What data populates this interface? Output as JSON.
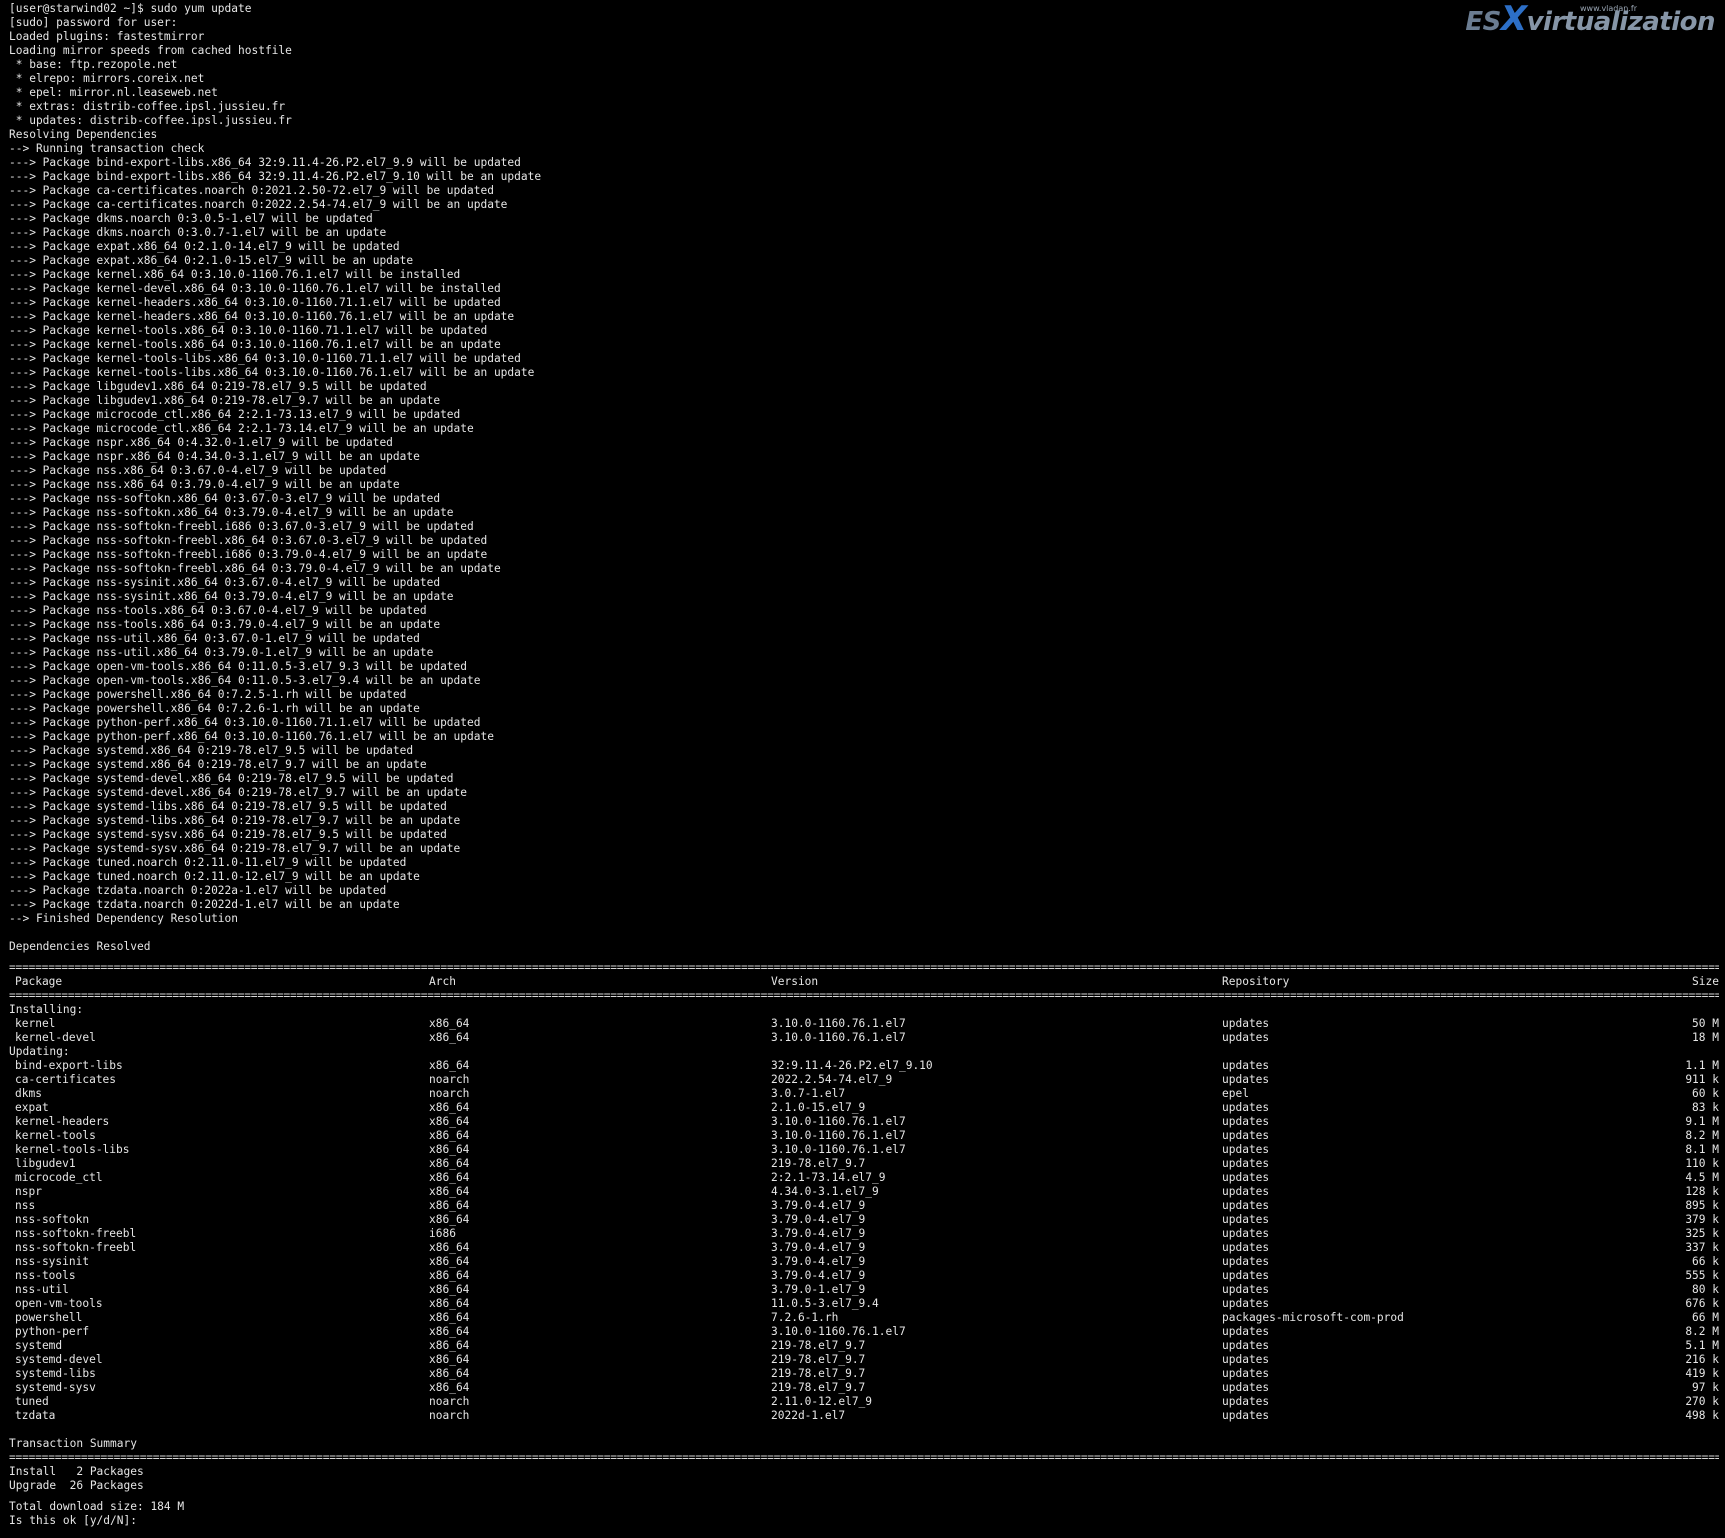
{
  "watermark": {
    "small": "www.vladan.fr",
    "es": "ES",
    "x": "X",
    "rest": "virtualization"
  },
  "log_lines": [
    "[user@starwind02 ~]$ sudo yum update",
    "[sudo] password for user:",
    "Loaded plugins: fastestmirror",
    "Loading mirror speeds from cached hostfile",
    " * base: ftp.rezopole.net",
    " * elrepo: mirrors.coreix.net",
    " * epel: mirror.nl.leaseweb.net",
    " * extras: distrib-coffee.ipsl.jussieu.fr",
    " * updates: distrib-coffee.ipsl.jussieu.fr",
    "Resolving Dependencies",
    "--> Running transaction check",
    "---> Package bind-export-libs.x86_64 32:9.11.4-26.P2.el7_9.9 will be updated",
    "---> Package bind-export-libs.x86_64 32:9.11.4-26.P2.el7_9.10 will be an update",
    "---> Package ca-certificates.noarch 0:2021.2.50-72.el7_9 will be updated",
    "---> Package ca-certificates.noarch 0:2022.2.54-74.el7_9 will be an update",
    "---> Package dkms.noarch 0:3.0.5-1.el7 will be updated",
    "---> Package dkms.noarch 0:3.0.7-1.el7 will be an update",
    "---> Package expat.x86_64 0:2.1.0-14.el7_9 will be updated",
    "---> Package expat.x86_64 0:2.1.0-15.el7_9 will be an update",
    "---> Package kernel.x86_64 0:3.10.0-1160.76.1.el7 will be installed",
    "---> Package kernel-devel.x86_64 0:3.10.0-1160.76.1.el7 will be installed",
    "---> Package kernel-headers.x86_64 0:3.10.0-1160.71.1.el7 will be updated",
    "---> Package kernel-headers.x86_64 0:3.10.0-1160.76.1.el7 will be an update",
    "---> Package kernel-tools.x86_64 0:3.10.0-1160.71.1.el7 will be updated",
    "---> Package kernel-tools.x86_64 0:3.10.0-1160.76.1.el7 will be an update",
    "---> Package kernel-tools-libs.x86_64 0:3.10.0-1160.71.1.el7 will be updated",
    "---> Package kernel-tools-libs.x86_64 0:3.10.0-1160.76.1.el7 will be an update",
    "---> Package libgudev1.x86_64 0:219-78.el7_9.5 will be updated",
    "---> Package libgudev1.x86_64 0:219-78.el7_9.7 will be an update",
    "---> Package microcode_ctl.x86_64 2:2.1-73.13.el7_9 will be updated",
    "---> Package microcode_ctl.x86_64 2:2.1-73.14.el7_9 will be an update",
    "---> Package nspr.x86_64 0:4.32.0-1.el7_9 will be updated",
    "---> Package nspr.x86_64 0:4.34.0-3.1.el7_9 will be an update",
    "---> Package nss.x86_64 0:3.67.0-4.el7_9 will be updated",
    "---> Package nss.x86_64 0:3.79.0-4.el7_9 will be an update",
    "---> Package nss-softokn.x86_64 0:3.67.0-3.el7_9 will be updated",
    "---> Package nss-softokn.x86_64 0:3.79.0-4.el7_9 will be an update",
    "---> Package nss-softokn-freebl.i686 0:3.67.0-3.el7_9 will be updated",
    "---> Package nss-softokn-freebl.x86_64 0:3.67.0-3.el7_9 will be updated",
    "---> Package nss-softokn-freebl.i686 0:3.79.0-4.el7_9 will be an update",
    "---> Package nss-softokn-freebl.x86_64 0:3.79.0-4.el7_9 will be an update",
    "---> Package nss-sysinit.x86_64 0:3.67.0-4.el7_9 will be updated",
    "---> Package nss-sysinit.x86_64 0:3.79.0-4.el7_9 will be an update",
    "---> Package nss-tools.x86_64 0:3.67.0-4.el7_9 will be updated",
    "---> Package nss-tools.x86_64 0:3.79.0-4.el7_9 will be an update",
    "---> Package nss-util.x86_64 0:3.67.0-1.el7_9 will be updated",
    "---> Package nss-util.x86_64 0:3.79.0-1.el7_9 will be an update",
    "---> Package open-vm-tools.x86_64 0:11.0.5-3.el7_9.3 will be updated",
    "---> Package open-vm-tools.x86_64 0:11.0.5-3.el7_9.4 will be an update",
    "---> Package powershell.x86_64 0:7.2.5-1.rh will be updated",
    "---> Package powershell.x86_64 0:7.2.6-1.rh will be an update",
    "---> Package python-perf.x86_64 0:3.10.0-1160.71.1.el7 will be updated",
    "---> Package python-perf.x86_64 0:3.10.0-1160.76.1.el7 will be an update",
    "---> Package systemd.x86_64 0:219-78.el7_9.5 will be updated",
    "---> Package systemd.x86_64 0:219-78.el7_9.7 will be an update",
    "---> Package systemd-devel.x86_64 0:219-78.el7_9.5 will be updated",
    "---> Package systemd-devel.x86_64 0:219-78.el7_9.7 will be an update",
    "---> Package systemd-libs.x86_64 0:219-78.el7_9.5 will be updated",
    "---> Package systemd-libs.x86_64 0:219-78.el7_9.7 will be an update",
    "---> Package systemd-sysv.x86_64 0:219-78.el7_9.5 will be updated",
    "---> Package systemd-sysv.x86_64 0:219-78.el7_9.7 will be an update",
    "---> Package tuned.noarch 0:2.11.0-11.el7_9 will be updated",
    "---> Package tuned.noarch 0:2.11.0-12.el7_9 will be an update",
    "---> Package tzdata.noarch 0:2022a-1.el7 will be updated",
    "---> Package tzdata.noarch 0:2022d-1.el7 will be an update",
    "--> Finished Dependency Resolution"
  ],
  "resolved": "Dependencies Resolved",
  "separator": "================================================================================================================================================================================================================================================================================",
  "table": {
    "headers": {
      "package": "Package",
      "arch": "Arch",
      "version": "Version",
      "repository": "Repository",
      "size": "Size"
    },
    "installing_label": "Installing:",
    "installing": [
      {
        "package": "kernel",
        "arch": "x86_64",
        "version": "3.10.0-1160.76.1.el7",
        "repository": "updates",
        "size": "50 M"
      },
      {
        "package": "kernel-devel",
        "arch": "x86_64",
        "version": "3.10.0-1160.76.1.el7",
        "repository": "updates",
        "size": "18 M"
      }
    ],
    "updating_label": "Updating:",
    "updating": [
      {
        "package": "bind-export-libs",
        "arch": "x86_64",
        "version": "32:9.11.4-26.P2.el7_9.10",
        "repository": "updates",
        "size": "1.1 M"
      },
      {
        "package": "ca-certificates",
        "arch": "noarch",
        "version": "2022.2.54-74.el7_9",
        "repository": "updates",
        "size": "911 k"
      },
      {
        "package": "dkms",
        "arch": "noarch",
        "version": "3.0.7-1.el7",
        "repository": "epel",
        "size": "60 k"
      },
      {
        "package": "expat",
        "arch": "x86_64",
        "version": "2.1.0-15.el7_9",
        "repository": "updates",
        "size": "83 k"
      },
      {
        "package": "kernel-headers",
        "arch": "x86_64",
        "version": "3.10.0-1160.76.1.el7",
        "repository": "updates",
        "size": "9.1 M"
      },
      {
        "package": "kernel-tools",
        "arch": "x86_64",
        "version": "3.10.0-1160.76.1.el7",
        "repository": "updates",
        "size": "8.2 M"
      },
      {
        "package": "kernel-tools-libs",
        "arch": "x86_64",
        "version": "3.10.0-1160.76.1.el7",
        "repository": "updates",
        "size": "8.1 M"
      },
      {
        "package": "libgudev1",
        "arch": "x86_64",
        "version": "219-78.el7_9.7",
        "repository": "updates",
        "size": "110 k"
      },
      {
        "package": "microcode_ctl",
        "arch": "x86_64",
        "version": "2:2.1-73.14.el7_9",
        "repository": "updates",
        "size": "4.5 M"
      },
      {
        "package": "nspr",
        "arch": "x86_64",
        "version": "4.34.0-3.1.el7_9",
        "repository": "updates",
        "size": "128 k"
      },
      {
        "package": "nss",
        "arch": "x86_64",
        "version": "3.79.0-4.el7_9",
        "repository": "updates",
        "size": "895 k"
      },
      {
        "package": "nss-softokn",
        "arch": "x86_64",
        "version": "3.79.0-4.el7_9",
        "repository": "updates",
        "size": "379 k"
      },
      {
        "package": "nss-softokn-freebl",
        "arch": "i686",
        "version": "3.79.0-4.el7_9",
        "repository": "updates",
        "size": "325 k"
      },
      {
        "package": "nss-softokn-freebl",
        "arch": "x86_64",
        "version": "3.79.0-4.el7_9",
        "repository": "updates",
        "size": "337 k"
      },
      {
        "package": "nss-sysinit",
        "arch": "x86_64",
        "version": "3.79.0-4.el7_9",
        "repository": "updates",
        "size": "66 k"
      },
      {
        "package": "nss-tools",
        "arch": "x86_64",
        "version": "3.79.0-4.el7_9",
        "repository": "updates",
        "size": "555 k"
      },
      {
        "package": "nss-util",
        "arch": "x86_64",
        "version": "3.79.0-1.el7_9",
        "repository": "updates",
        "size": "80 k"
      },
      {
        "package": "open-vm-tools",
        "arch": "x86_64",
        "version": "11.0.5-3.el7_9.4",
        "repository": "updates",
        "size": "676 k"
      },
      {
        "package": "powershell",
        "arch": "x86_64",
        "version": "7.2.6-1.rh",
        "repository": "packages-microsoft-com-prod",
        "size": "66 M"
      },
      {
        "package": "python-perf",
        "arch": "x86_64",
        "version": "3.10.0-1160.76.1.el7",
        "repository": "updates",
        "size": "8.2 M"
      },
      {
        "package": "systemd",
        "arch": "x86_64",
        "version": "219-78.el7_9.7",
        "repository": "updates",
        "size": "5.1 M"
      },
      {
        "package": "systemd-devel",
        "arch": "x86_64",
        "version": "219-78.el7_9.7",
        "repository": "updates",
        "size": "216 k"
      },
      {
        "package": "systemd-libs",
        "arch": "x86_64",
        "version": "219-78.el7_9.7",
        "repository": "updates",
        "size": "419 k"
      },
      {
        "package": "systemd-sysv",
        "arch": "x86_64",
        "version": "219-78.el7_9.7",
        "repository": "updates",
        "size": "97 k"
      },
      {
        "package": "tuned",
        "arch": "noarch",
        "version": "2.11.0-12.el7_9",
        "repository": "updates",
        "size": "270 k"
      },
      {
        "package": "tzdata",
        "arch": "noarch",
        "version": "2022d-1.el7",
        "repository": "updates",
        "size": "498 k"
      }
    ]
  },
  "summary": {
    "title": "Transaction Summary",
    "install": "Install   2 Packages",
    "upgrade": "Upgrade  26 Packages",
    "total": "Total download size: 184 M",
    "prompt": "Is this ok [y/d/N]:"
  }
}
